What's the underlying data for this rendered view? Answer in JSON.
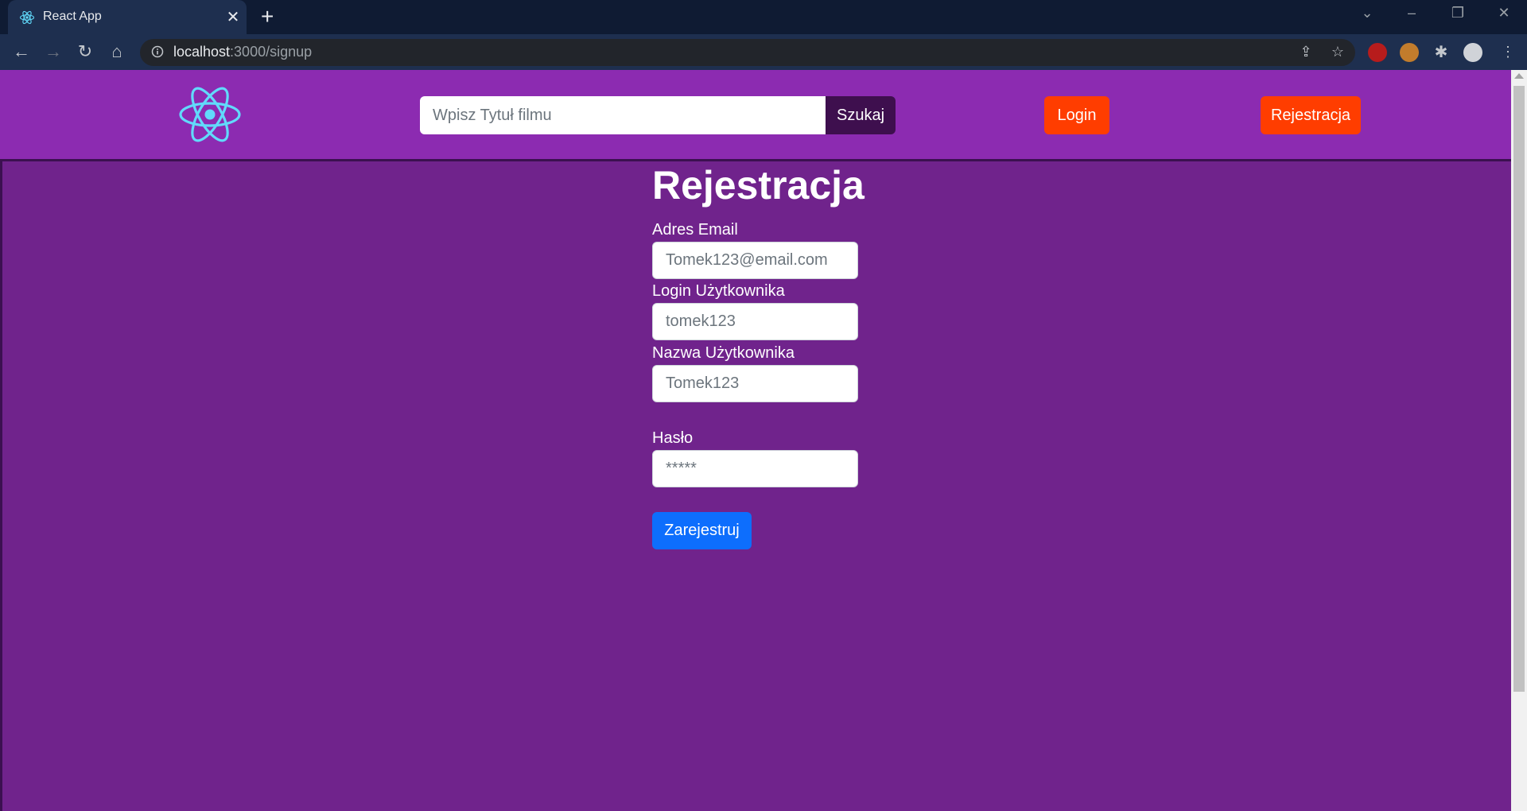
{
  "browser": {
    "tab_title": "React App",
    "url_host": "localhost",
    "url_path": ":3000/signup"
  },
  "header": {
    "search_placeholder": "Wpisz Tytuł filmu",
    "search_button": "Szukaj",
    "login_button": "Login",
    "signup_button": "Rejestracja"
  },
  "form": {
    "title": "Rejestracja",
    "email_label": "Adres Email",
    "email_placeholder": "Tomek123@email.com",
    "login_label": "Login Użytkownika",
    "login_placeholder": "tomek123",
    "name_label": "Nazwa Użytkownika",
    "name_placeholder": "Tomek123",
    "password_label": "Hasło",
    "password_placeholder": "*****",
    "submit_button": "Zarejestruj"
  },
  "colors": {
    "header_bg": "#8c2bb1",
    "page_bg": "#70238c",
    "accent_orange": "#ff3d00",
    "submit_blue": "#0d6efd",
    "search_button_bg": "#3e0f4e",
    "logo": "#61dafb"
  },
  "icons": [
    "react-logo-icon",
    "back-icon",
    "forward-icon",
    "reload-icon",
    "home-icon",
    "info-icon",
    "share-icon",
    "star-icon",
    "extensions-icon",
    "profile-icon",
    "menu-icon"
  ]
}
